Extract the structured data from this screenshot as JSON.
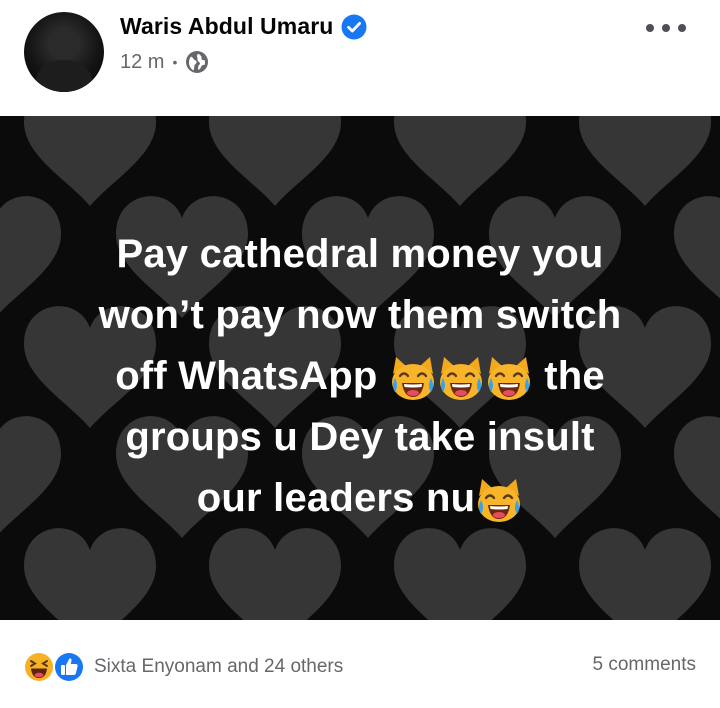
{
  "post": {
    "author": {
      "name": "Waris Abdul Umaru",
      "verified": true
    },
    "timestamp": "12 m",
    "separator": "•",
    "audience_icon": "globe-icon",
    "menu_icon": "more-options-icon",
    "background": {
      "color": "#0b0b0b",
      "pattern": "heart-icon",
      "pattern_color": "#3a3a3a"
    },
    "text_lines": [
      "Pay cathedral money you",
      "won’t pay now them switch",
      "off WhatsApp",
      "the",
      "groups u Dey take insult",
      "our leaders nu"
    ],
    "emoji": "cat-tears-of-joy-icon"
  },
  "footer": {
    "reaction_icons": [
      "haha-icon",
      "like-icon"
    ],
    "reactors_label": "Sixta Enyonam and 24 others",
    "comments_label": "5 comments"
  },
  "colors": {
    "verified_badge": "#1877f2",
    "like_badge": "#1877f2",
    "haha_face": "#f7b125",
    "secondary_text": "#65676b"
  }
}
